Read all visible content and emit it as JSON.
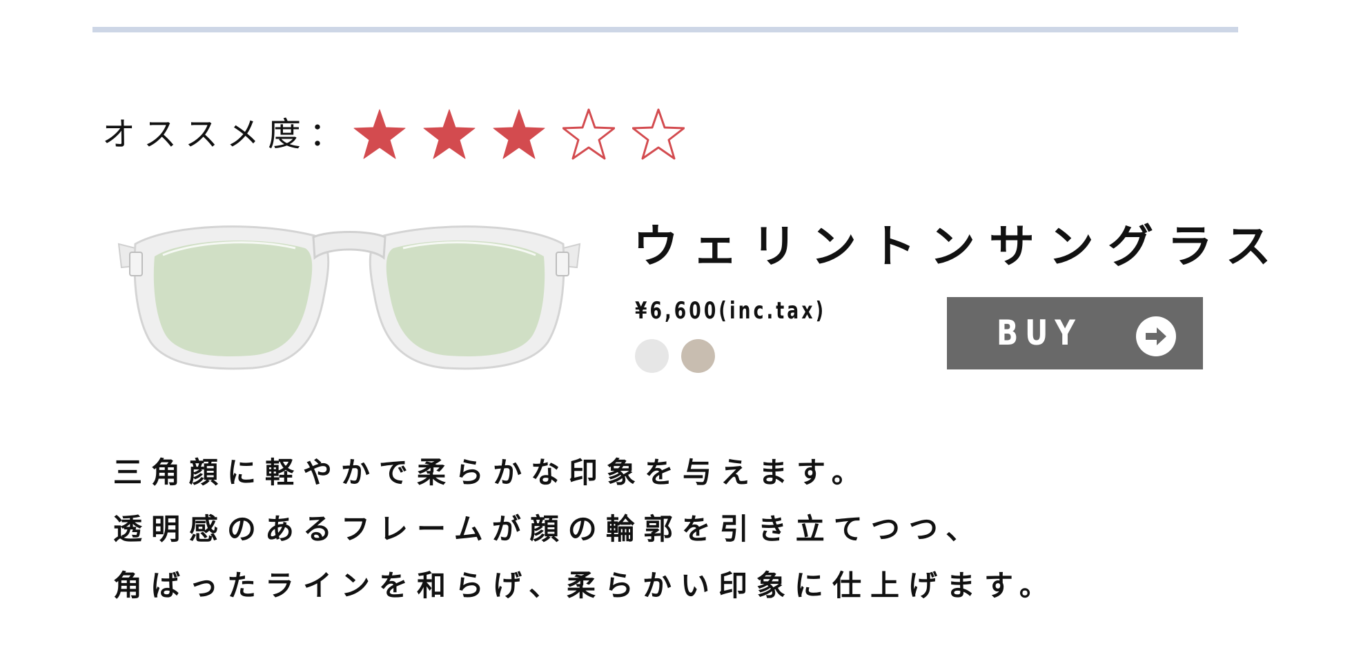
{
  "rating": {
    "label": "オススメ度：",
    "value": 3,
    "max": 5,
    "star_color": "#d34b4f"
  },
  "product": {
    "image_icon": "clear-wellington-sunglasses",
    "name": "ウェリントンサングラス",
    "price": "¥6,600(inc.tax)",
    "swatches": [
      {
        "color": "#e6e6e6"
      },
      {
        "color": "#c8bdb0"
      }
    ],
    "buy_label": "BUY",
    "buy_icon": "arrow-right-circle-icon",
    "buy_button_color": "#696969"
  },
  "description": {
    "lines": [
      "三角顔に軽やかで柔らかな印象を与えます。",
      "透明感のあるフレームが顔の輪郭を引き立てつつ、",
      "角ばったラインを和らげ、柔らかい印象に仕上げます。"
    ]
  }
}
